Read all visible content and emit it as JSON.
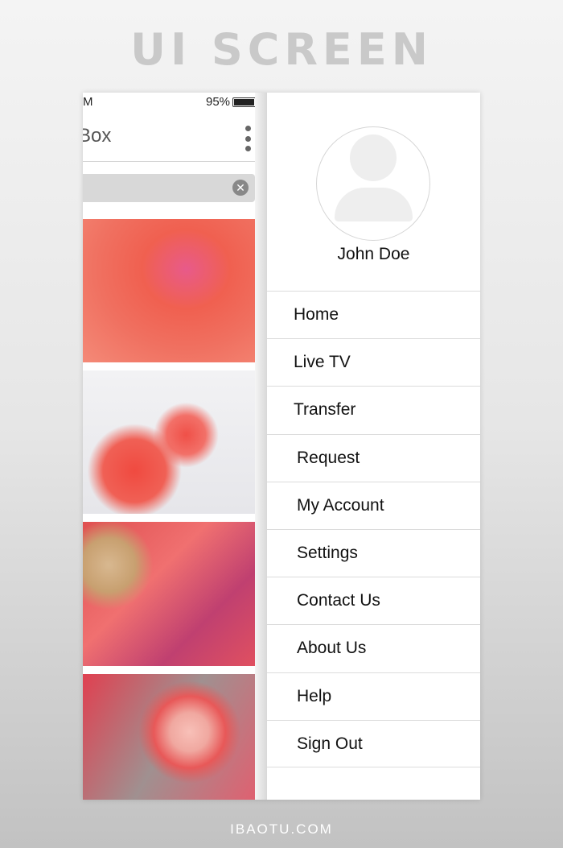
{
  "header": {
    "title": "UI SCREEN"
  },
  "footer": {
    "text": "IBAOTU.COM"
  },
  "status": {
    "time_fragment": "M",
    "battery": "95%"
  },
  "app": {
    "title_fragment": "Box"
  },
  "search": {
    "clear_icon": "close-circle-icon"
  },
  "user": {
    "name": "John Doe"
  },
  "menu": {
    "items": [
      {
        "label": "Home"
      },
      {
        "label": "Live TV"
      },
      {
        "label": "Transfer"
      },
      {
        "label": "Request"
      },
      {
        "label": "My Account"
      },
      {
        "label": "Settings"
      },
      {
        "label": "Contact Us"
      },
      {
        "label": "About Us"
      },
      {
        "label": "Help"
      },
      {
        "label": "Sign Out"
      }
    ]
  },
  "colors": {
    "accent": "#f0645a"
  }
}
